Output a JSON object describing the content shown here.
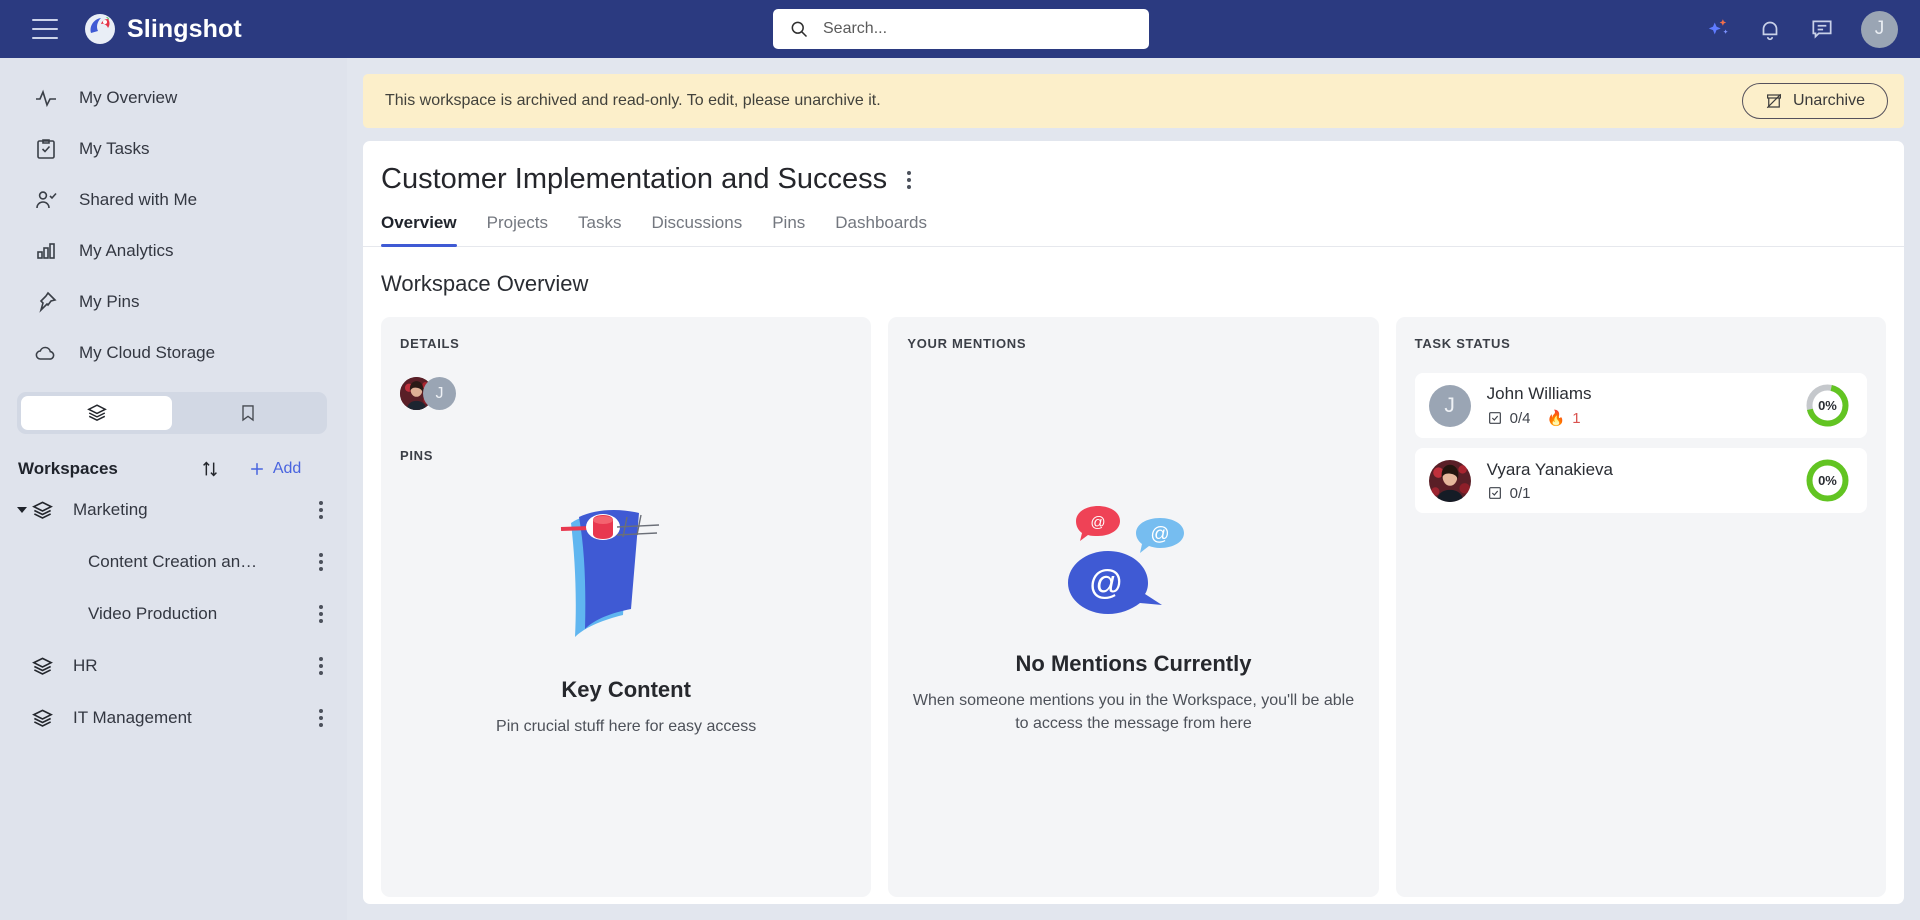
{
  "topbar": {
    "brand": "Slingshot",
    "menu_icon": "hamburger-icon",
    "search": {
      "placeholder": "Search...",
      "value": ""
    },
    "icons": [
      "ai-sparkle-icon",
      "notifications-bell-icon",
      "messages-icon"
    ],
    "avatar_initial": "J"
  },
  "sidebar": {
    "nav": [
      {
        "label": "My Overview",
        "icon": "activity-icon"
      },
      {
        "label": "My Tasks",
        "icon": "task-checklist-icon"
      },
      {
        "label": "Shared with Me",
        "icon": "user-check-icon"
      },
      {
        "label": "My Analytics",
        "icon": "bar-chart-icon"
      },
      {
        "label": "My Pins",
        "icon": "pin-icon"
      },
      {
        "label": "My Cloud Storage",
        "icon": "cloud-icon"
      }
    ],
    "segments": [
      {
        "icon": "layers-icon",
        "active": true
      },
      {
        "icon": "bookmark-icon",
        "active": false
      }
    ],
    "workspaces_title": "Workspaces",
    "sort_icon": "sort-arrows-icon",
    "add_label": "Add",
    "tree": [
      {
        "label": "Marketing",
        "level": 0,
        "expanded": true,
        "icon": "layers-icon"
      },
      {
        "label": "Content Creation an…",
        "level": 1
      },
      {
        "label": "Video Production",
        "level": 1
      },
      {
        "label": "HR",
        "level": 0,
        "expanded": false,
        "icon": "layers-icon"
      },
      {
        "label": "IT Management",
        "level": 0,
        "expanded": false,
        "icon": "layers-icon"
      }
    ]
  },
  "banner": {
    "message": "This workspace is archived and read-only. To edit, please unarchive it.",
    "button_label": "Unarchive",
    "button_icon": "unarchive-box-icon",
    "background": "#fcefca"
  },
  "page": {
    "title": "Customer Implementation and Success",
    "menu_icon": "kebab-menu-icon",
    "tabs": [
      {
        "label": "Overview",
        "active": true
      },
      {
        "label": "Projects",
        "active": false
      },
      {
        "label": "Tasks",
        "active": false
      },
      {
        "label": "Discussions",
        "active": false
      },
      {
        "label": "Pins",
        "active": false
      },
      {
        "label": "Dashboards",
        "active": false
      }
    ],
    "section_title": "Workspace Overview",
    "accent_color": "#3f5ad4"
  },
  "details_card": {
    "title": "DETAILS",
    "members": [
      {
        "type": "photo",
        "name": "Vyara Yanakieva"
      },
      {
        "type": "initial",
        "initial": "J",
        "name": "John Williams"
      }
    ],
    "pins_label": "PINS",
    "empty_title": "Key Content",
    "empty_text": "Pin crucial stuff here for easy access",
    "empty_icon": "pinned-page-illustration"
  },
  "mentions_card": {
    "title": "YOUR MENTIONS",
    "empty_title": "No Mentions Currently",
    "empty_text": "When someone mentions you in the Workspace, you'll be able to access the message from here",
    "empty_icon": "mention-bubbles-illustration"
  },
  "task_status_card": {
    "title": "TASK STATUS",
    "rows": [
      {
        "name": "John Williams",
        "avatar_type": "initial",
        "avatar_initial": "J",
        "checklist_icon": "checkbox-icon",
        "completed_label": "0/4",
        "overdue_icon": "fire-icon",
        "overdue_label": "1",
        "percent_label": "0%",
        "ring_progress": 68,
        "ring_color": "#62c422",
        "ring_track": "#c5c8cc"
      },
      {
        "name": "Vyara Yanakieva",
        "avatar_type": "photo",
        "checklist_icon": "checkbox-icon",
        "completed_label": "0/1",
        "overdue_icon": null,
        "overdue_label": "",
        "percent_label": "0%",
        "ring_progress": 100,
        "ring_color": "#62c422",
        "ring_track": "#62c422"
      }
    ]
  }
}
